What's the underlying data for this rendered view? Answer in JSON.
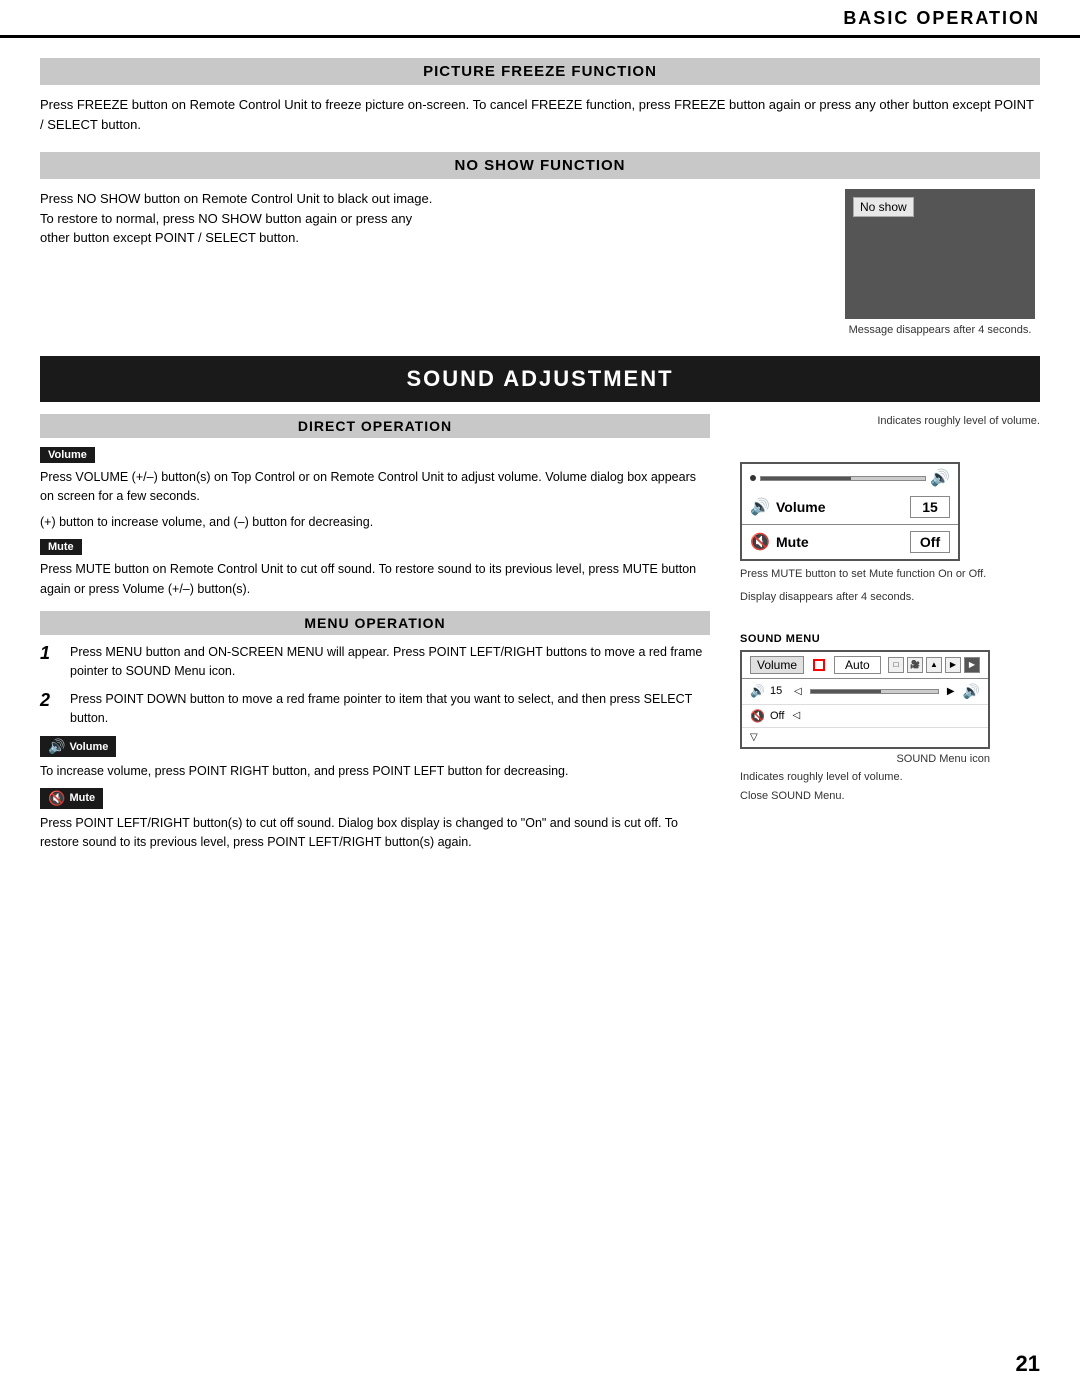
{
  "header": {
    "title": "BASIC OPERATION"
  },
  "picture_freeze": {
    "section_title": "PICTURE FREEZE FUNCTION",
    "description": "Press FREEZE button on Remote Control Unit to freeze picture on-screen. To cancel FREEZE function, press FREEZE button again or press any other button except POINT / SELECT button."
  },
  "no_show": {
    "section_title": "NO SHOW FUNCTION",
    "description_line1": "Press NO SHOW button on Remote Control Unit to black out image.",
    "description_line2": "To restore to normal, press NO SHOW button again or press any",
    "description_line3": "other button except POINT / SELECT button.",
    "image_label": "No show",
    "caption": "Message disappears after 4 seconds."
  },
  "sound_adjustment": {
    "section_title": "SOUND ADJUSTMENT",
    "direct_operation": {
      "section_title": "DIRECT OPERATION",
      "volume_badge": "Volume",
      "volume_text": "Press VOLUME (+/–) button(s) on Top Control or on Remote Control Unit to adjust volume. Volume dialog box appears on screen for a few seconds.",
      "volume_text2": "(+) button to increase volume, and (–) button for decreasing.",
      "mute_badge": "Mute",
      "mute_text": "Press MUTE button on Remote Control Unit to cut off sound.  To restore sound to its previous level, press MUTE button again or press Volume (+/–) button(s)."
    },
    "menu_operation": {
      "section_title": "MENU OPERATION",
      "step1": "Press MENU button and ON-SCREEN MENU will appear.  Press POINT LEFT/RIGHT buttons to move a red frame pointer to SOUND Menu icon.",
      "step2": "Press POINT DOWN button to move a red frame pointer to item that you want to select, and then press SELECT button.",
      "volume_badge": "Volume",
      "volume_text": "To increase volume, press POINT RIGHT button, and press POINT LEFT button for decreasing.",
      "mute_badge": "Mute",
      "mute_text": "Press POINT LEFT/RIGHT button(s) to cut off sound.  Dialog box display is changed to \"On\" and sound is cut off.  To restore sound to its previous level, press POINT LEFT/RIGHT button(s) again."
    },
    "dialog": {
      "volume_label": "Volume",
      "volume_value": "15",
      "mute_label": "Mute",
      "mute_value": "Off",
      "indicates_level": "Indicates roughly level of\nvolume.",
      "press_mute": "Press MUTE button to set\nMute function On or Off.",
      "display_disappears": "Display disappears after 4 seconds."
    },
    "sound_menu": {
      "label": "SOUND MENU",
      "tab_label": "Volume",
      "mode_label": "Auto",
      "volume_value": "15",
      "mute_value": "Off",
      "sound_menu_icon": "SOUND Menu icon",
      "indicates_roughly": "Indicates roughly\nlevel of volume.",
      "close_label": "Close SOUND Menu."
    }
  },
  "page_number": "21"
}
